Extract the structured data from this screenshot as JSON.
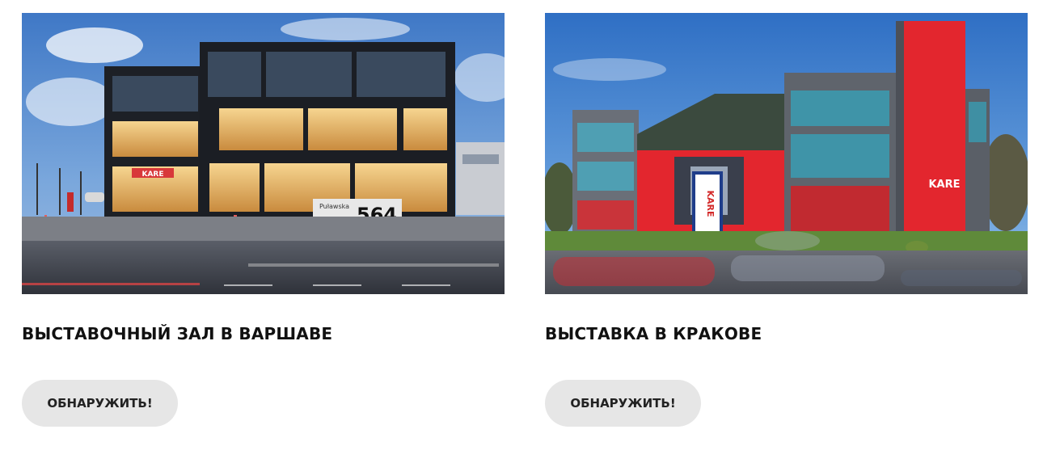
{
  "cards": [
    {
      "image_alt": "Warsaw showroom building at dusk",
      "title": "ВЫСТАВОЧНЫЙ ЗАЛ В ВАРШАВЕ",
      "button_label": "ОБНАРУЖИТЬ!",
      "sign_text": "KARE",
      "street_sign": "Puławska",
      "house_number": "564"
    },
    {
      "image_alt": "Krakow exhibition red building",
      "title": "ВЫСТАВКА В КРАКОВЕ",
      "button_label": "ОБНАРУЖИТЬ!",
      "sign_text": "KARE",
      "pylon_text": "KARE"
    }
  ]
}
